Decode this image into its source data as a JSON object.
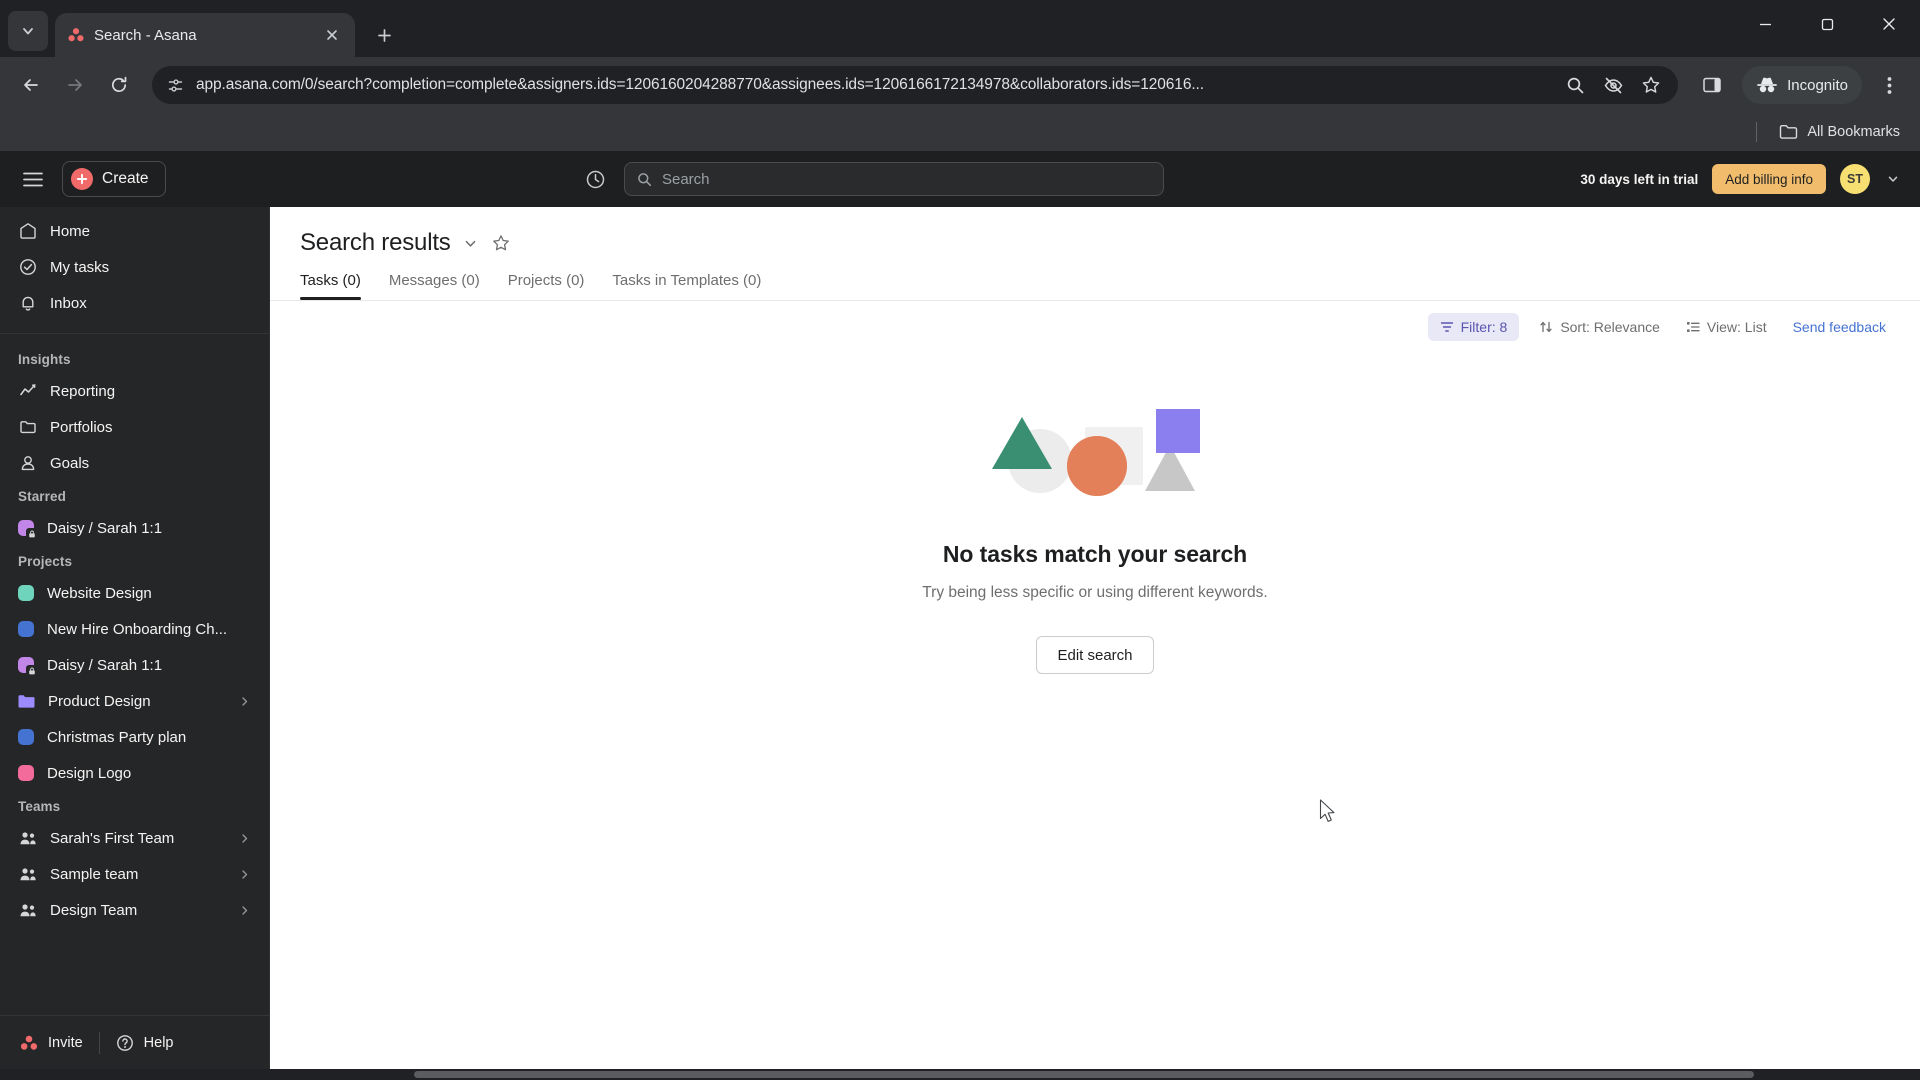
{
  "browser": {
    "tab": {
      "title": "Search - Asana",
      "favicon_icon": "asana-logo-icon"
    },
    "tab_list_icon": "chevron-down-icon",
    "new_tab_icon": "plus-icon",
    "close_tab_icon": "close-icon",
    "window_controls": {
      "minimize": "minimize-icon",
      "maximize": "maximize-icon",
      "close": "close-icon"
    },
    "nav": {
      "back_icon": "arrow-left-icon",
      "forward_icon": "arrow-right-icon",
      "reload_icon": "reload-icon"
    },
    "omnibox": {
      "site_info_icon": "page-settings-icon",
      "url": "app.asana.com/0/search?completion=complete&assigners.ids=1206160204288770&assignees.ids=1206166172134978&collaborators.ids=120616...",
      "zoom_icon": "search-zoom-icon",
      "tracking_icon": "eye-off-icon",
      "bookmark_icon": "star-icon"
    },
    "split_view_icon": "side-panel-icon",
    "incognito": {
      "label": "Incognito",
      "icon": "incognito-hat-icon"
    },
    "menu_icon": "kebab-menu-icon",
    "bookmarks_bar": {
      "label": "All Bookmarks",
      "icon": "folder-icon"
    }
  },
  "asana_header": {
    "hamburger_icon": "hamburger-menu-icon",
    "create_label": "Create",
    "create_icon": "plus-icon",
    "recents_icon": "clock-icon",
    "search": {
      "placeholder": "Search",
      "icon": "search-icon"
    },
    "trial_text": "30 days left in trial",
    "billing_label": "Add billing info",
    "avatar_initials": "ST",
    "avatar_chevron_icon": "chevron-down-icon"
  },
  "sidebar": {
    "top_items": [
      {
        "label": "Home",
        "icon": "home-icon"
      },
      {
        "label": "My tasks",
        "icon": "check-circle-icon"
      },
      {
        "label": "Inbox",
        "icon": "bell-icon"
      }
    ],
    "insights": {
      "title": "Insights",
      "items": [
        {
          "label": "Reporting",
          "icon": "chart-line-icon"
        },
        {
          "label": "Portfolios",
          "icon": "folder-icon"
        },
        {
          "label": "Goals",
          "icon": "target-person-icon"
        }
      ]
    },
    "starred": {
      "title": "Starred",
      "items": [
        {
          "label": "Daisy / Sarah 1:1",
          "color": "#c285e8",
          "private": true,
          "type": "dot"
        }
      ]
    },
    "projects": {
      "title": "Projects",
      "items": [
        {
          "label": "Website Design",
          "color": "#6fd4bc",
          "private": false,
          "type": "dot",
          "expandable": false
        },
        {
          "label": "New Hire Onboarding Ch...",
          "color": "#4573d2",
          "private": false,
          "type": "dot",
          "expandable": false
        },
        {
          "label": "Daisy / Sarah 1:1",
          "color": "#c285e8",
          "private": true,
          "type": "dot",
          "expandable": false
        },
        {
          "label": "Product Design",
          "color": "#9c8bfa",
          "private": false,
          "type": "folder",
          "expandable": true
        },
        {
          "label": "Christmas Party plan",
          "color": "#4573d2",
          "private": false,
          "type": "dot",
          "expandable": false
        },
        {
          "label": "Design Logo",
          "color": "#f26b9a",
          "private": false,
          "type": "dot",
          "expandable": false
        }
      ]
    },
    "teams": {
      "title": "Teams",
      "items": [
        {
          "label": "Sarah's First Team",
          "icon": "people-icon",
          "expandable": true
        },
        {
          "label": "Sample team",
          "icon": "people-icon",
          "expandable": true
        },
        {
          "label": "Design Team",
          "icon": "people-icon",
          "expandable": true
        }
      ]
    },
    "footer": {
      "invite_label": "Invite",
      "invite_icon": "asana-logo-icon",
      "help_label": "Help",
      "help_icon": "question-circle-icon"
    }
  },
  "main": {
    "page_title": "Search results",
    "title_chevron_icon": "chevron-down-icon",
    "title_star_icon": "star-outline-icon",
    "tabs": [
      {
        "label": "Tasks (0)",
        "active": true
      },
      {
        "label": "Messages (0)",
        "active": false
      },
      {
        "label": "Projects (0)",
        "active": false
      },
      {
        "label": "Tasks in Templates (0)",
        "active": false
      }
    ],
    "toolbar": {
      "filter_label": "Filter: 8",
      "filter_icon": "filter-icon",
      "sort_label": "Sort: Relevance",
      "sort_icon": "sort-arrows-icon",
      "view_label": "View: List",
      "view_icon": "list-view-icon",
      "feedback_label": "Send feedback"
    },
    "empty_state": {
      "illustration_icon": "shapes-illustration",
      "title": "No tasks match your search",
      "subtitle": "Try being less specific or using different keywords.",
      "button_label": "Edit search"
    }
  },
  "colors": {
    "asana_accent": "#f06a6a",
    "filter_active_bg": "#e8e8f7",
    "filter_active_fg": "#5a55af",
    "link_blue": "#4573d2",
    "billing_orange": "#f1bd6c",
    "avatar_yellow": "#f8df72"
  }
}
